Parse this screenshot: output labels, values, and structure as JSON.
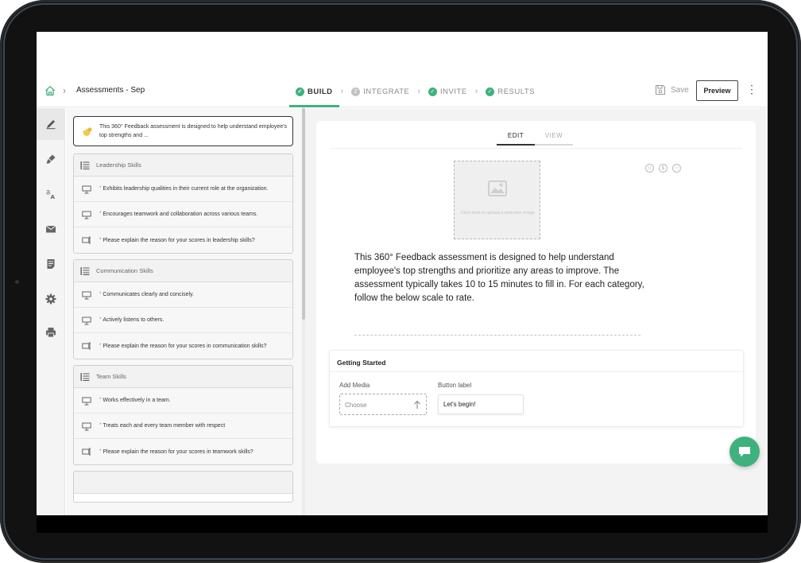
{
  "header": {
    "title": "Assessments - Sep",
    "save_label": "Save",
    "preview_label": "Preview"
  },
  "steps": [
    {
      "label": "BUILD",
      "state": "done",
      "active": true
    },
    {
      "label": "INTEGRATE",
      "state": "numbered",
      "number": "2",
      "active": false
    },
    {
      "label": "INVITE",
      "state": "done",
      "active": false
    },
    {
      "label": "RESULTS",
      "state": "done",
      "active": false
    }
  ],
  "rail": [
    "pencil-icon",
    "brush-icon",
    "translate-icon",
    "mail-icon",
    "report-icon",
    "gear-icon",
    "printer-icon"
  ],
  "outline": {
    "intro_text": "This 360° Feedback assessment is designed to help  understand employee's top strengths and ...",
    "sections": [
      {
        "title": "Leadership Skills",
        "questions": [
          {
            "type": "rating",
            "text": "Exhibits leadership qualities in their current role at the organization."
          },
          {
            "type": "rating",
            "text": "Encourages teamwork and collaboration across various teams."
          },
          {
            "type": "text",
            "text": "Please explain the reason for your scores in leadership skills?"
          }
        ]
      },
      {
        "title": "Communication Skills",
        "questions": [
          {
            "type": "rating",
            "text": "Communicates clearly and concisely."
          },
          {
            "type": "rating",
            "text": "Actively listens to others."
          },
          {
            "type": "text",
            "text": "Please explain the reason for your scores in communication skills?"
          }
        ]
      },
      {
        "title": "Team Skills",
        "questions": [
          {
            "type": "rating",
            "text": "Works effectively in a team."
          },
          {
            "type": "rating",
            "text": "Treats each and every team member with respect"
          },
          {
            "type": "text",
            "text": "Please explain the reason for your scores in teamwork skills?"
          }
        ]
      }
    ]
  },
  "editor": {
    "tabs": [
      "EDIT",
      "VIEW"
    ],
    "image_placeholder": "Click here to upload a welcome image",
    "intro_body": "This 360° Feedback assessment is designed to help  understand employee's top strengths and prioritize any areas to improve. The assessment typically takes 10 to 15 minutes to fill in. For each category, follow the below scale to rate.",
    "getting_started": {
      "title": "Getting Started",
      "media_label": "Add Media",
      "media_placeholder": "Choose",
      "button_label_label": "Button label",
      "button_label_value": "Let's begin!"
    }
  },
  "colors": {
    "accent": "#3fb17e",
    "frame": "#121212"
  }
}
